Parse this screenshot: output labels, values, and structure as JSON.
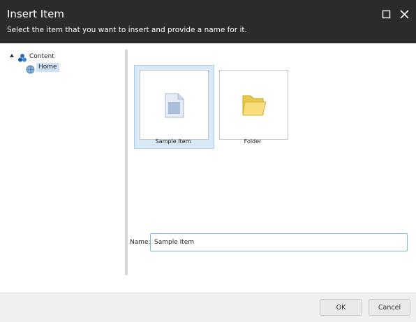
{
  "dialog": {
    "title": "Insert Item",
    "subtitle": "Select the item that you want to insert and provide a name for it."
  },
  "window_controls": {
    "maximize_icon": "maximize-icon",
    "close_icon": "close-icon"
  },
  "tree": {
    "root": {
      "label": "Content",
      "icon": "content-tree-icon",
      "expanded": true
    },
    "children": [
      {
        "label": "Home",
        "icon": "home-globe-icon",
        "selected": true
      }
    ]
  },
  "templates": [
    {
      "label": "Sample Item",
      "icon": "document-icon",
      "selected": true
    },
    {
      "label": "Folder",
      "icon": "folder-icon",
      "selected": false
    }
  ],
  "name_field": {
    "label": "Name:",
    "value": "Sample Item"
  },
  "footer": {
    "ok_label": "OK",
    "cancel_label": "Cancel"
  },
  "colors": {
    "header_bg": "#2b2b2b",
    "selection_bg": "#cde3f5",
    "tile_selected_bg": "#d8e9f8",
    "input_border": "#7fb4e6",
    "footer_bg": "#f0f0f0"
  }
}
